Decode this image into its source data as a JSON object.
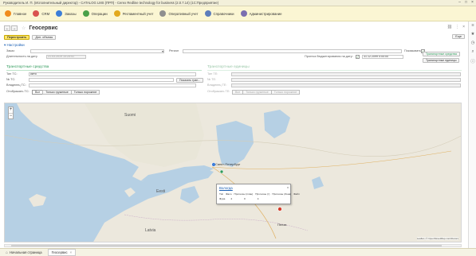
{
  "window": {
    "title": "Руководитель И. П. (Исполнительный директор) - CATALOG LMS (ПРП) - Cerex Redline technology for business (2.0.7.14) (1С:Предприятие)"
  },
  "sections": [
    {
      "label": "Главное",
      "color": "#f08c1e"
    },
    {
      "label": "CRM",
      "color": "#d9534f"
    },
    {
      "label": "Заказы",
      "color": "#3d7ed8"
    },
    {
      "label": "Операции",
      "color": "#4aa04a"
    },
    {
      "label": "Регламентный учет",
      "color": "#e2a91f"
    },
    {
      "label": "Оперативный учет",
      "color": "#8f8f8f"
    },
    {
      "label": "Справочники",
      "color": "#5d7dbb"
    },
    {
      "label": "Администрирование",
      "color": "#7b6fb0"
    }
  ],
  "page": {
    "title": "Геосервис",
    "more_label": "Еще"
  },
  "toolbar": {
    "refresh_label": "Перестроить",
    "options_label": "Доп. объекы"
  },
  "settings": {
    "header": "Настройки",
    "order_label": "Заказ",
    "region_label": "Регион",
    "show_label": "Показывать:",
    "time_label": "Длительность на дату",
    "time_value": "21.03.2019 10:25:41",
    "forecast_label": "Прогноз бюджетирования на дату:",
    "forecast_value": "31.12.2099 0:00:00",
    "vehicles_button": "Транспортные средства",
    "units_button": "Транспортные единицы"
  },
  "transport_vehicles": {
    "header": "Транспортные средства",
    "type_label": "Тип ТС:",
    "type_value": "Авто",
    "vehicle_label": "№ ТС:",
    "owner_label": "Владелец ТС:",
    "find_button": "Показать тран...",
    "display_label": "Отображать ТС:",
    "display_options": [
      "Все",
      "Только груженые",
      "Только порожние"
    ]
  },
  "transport_units": {
    "header": "Транспортные единицы",
    "type_label": "Тип ТЕ:",
    "unit_label": "№ ТЕ:",
    "owner_label": "Владелец ТЕ:",
    "display_label": "Отображать ТЕ:",
    "display_options": [
      "Все",
      "Только груженые",
      "Только порожние"
    ]
  },
  "map": {
    "labels": {
      "estonia": "Eesti",
      "latvia": "Latvia",
      "finland": "Suomi",
      "spb": "Санкт-Петербург",
      "city2": "Пенза"
    },
    "popup": {
      "title": "Вологда",
      "close": "x",
      "headers": [
        "Тип",
        "Фасо",
        "Прогнозы (план)",
        "Прогнозы (т)",
        "Прогнозы (Зона)",
        "Файл"
      ],
      "row": [
        "Фура",
        "4",
        "0",
        "4",
        "",
        ""
      ]
    },
    "attribution": "Leaflet | © OpenStreetMap contributors"
  },
  "taskbar": {
    "items": [
      {
        "label": "Начальная страница",
        "active": false
      },
      {
        "label": "Геосервис",
        "active": true
      }
    ]
  }
}
